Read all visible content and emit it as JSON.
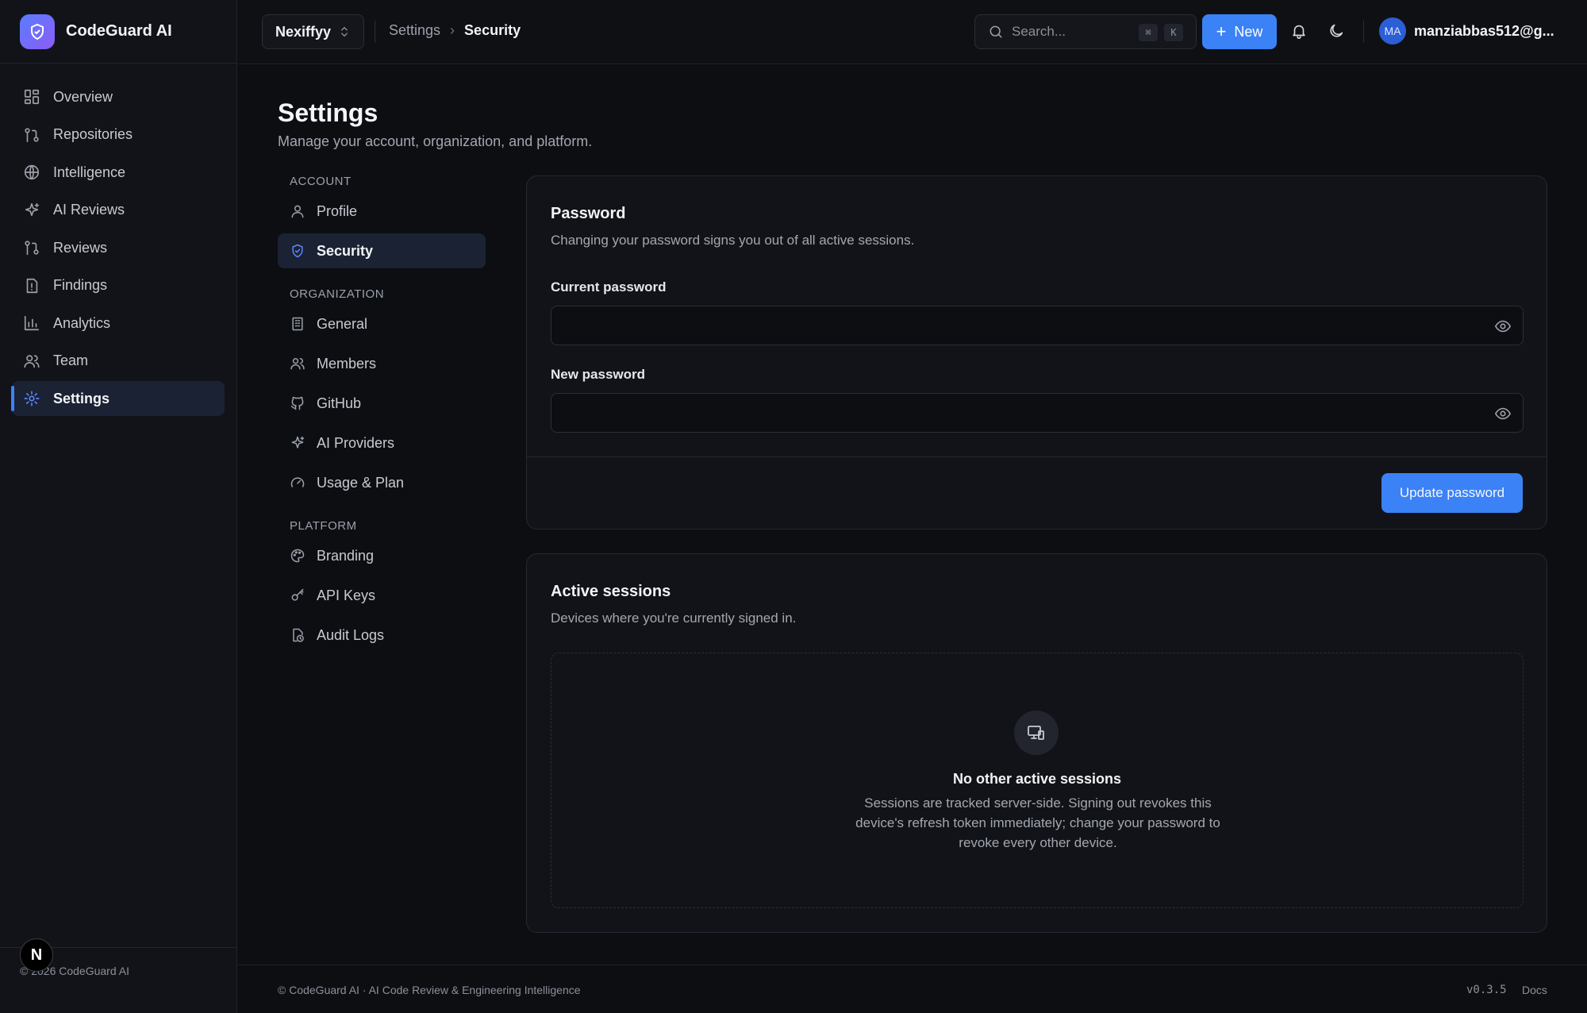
{
  "app": {
    "name": "CodeGuard AI"
  },
  "sidebar": {
    "items": [
      {
        "label": "Overview",
        "icon": "layout-dashboard-icon"
      },
      {
        "label": "Repositories",
        "icon": "git-pull-request-icon"
      },
      {
        "label": "Intelligence",
        "icon": "globe-icon"
      },
      {
        "label": "AI Reviews",
        "icon": "sparkles-icon"
      },
      {
        "label": "Reviews",
        "icon": "git-pull-request-icon"
      },
      {
        "label": "Findings",
        "icon": "file-alert-icon"
      },
      {
        "label": "Analytics",
        "icon": "bar-chart-icon"
      },
      {
        "label": "Team",
        "icon": "users-icon"
      },
      {
        "label": "Settings",
        "icon": "gear-icon",
        "active": true
      }
    ],
    "footer": "© 2026 CodeGuard AI",
    "badge": "N"
  },
  "topbar": {
    "org": "Nexiffyy",
    "breadcrumb": [
      "Settings",
      "Security"
    ],
    "search_placeholder": "Search...",
    "shortcut": [
      "⌘",
      "K"
    ],
    "new_label": "New",
    "avatar_initials": "MA",
    "user_email": "manziabbas512@g..."
  },
  "page": {
    "title": "Settings",
    "subtitle": "Manage your account, organization, and platform."
  },
  "settings_nav": {
    "groups": [
      {
        "label": "ACCOUNT",
        "items": [
          "Profile",
          "Security"
        ]
      },
      {
        "label": "ORGANIZATION",
        "items": [
          "General",
          "Members",
          "GitHub",
          "AI Providers",
          "Usage & Plan"
        ]
      },
      {
        "label": "PLATFORM",
        "items": [
          "Branding",
          "API Keys",
          "Audit Logs"
        ]
      }
    ],
    "active": "Security"
  },
  "password_card": {
    "title": "Password",
    "subtitle": "Changing your password signs you out of all active sessions.",
    "current_label": "Current password",
    "new_label": "New password",
    "current_value": "",
    "new_value": "",
    "submit_label": "Update password"
  },
  "sessions_card": {
    "title": "Active sessions",
    "subtitle": "Devices where you're currently signed in.",
    "empty_title": "No other active sessions",
    "empty_desc": "Sessions are tracked server-side. Signing out revokes this device's refresh token immediately; change your password to revoke every other device."
  },
  "footer": {
    "left": "© CodeGuard AI · AI Code Review & Engineering Intelligence",
    "version": "v0.3.5",
    "docs": "Docs"
  },
  "colors": {
    "accent": "#3b82f6",
    "background": "#0d0e12",
    "surface": "#121318"
  }
}
